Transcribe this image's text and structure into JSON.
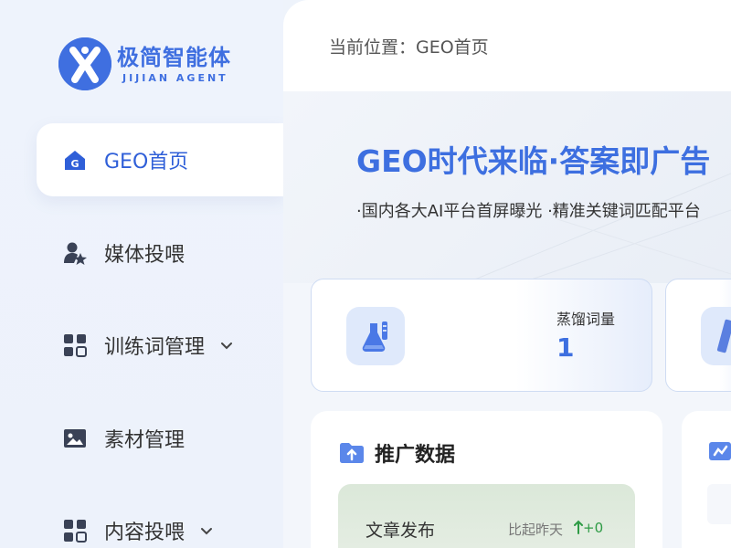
{
  "brand": {
    "name_cn": "极简智能体",
    "name_en": "JIJIAN AGENT",
    "primary_color": "#3f6fe0"
  },
  "sidebar": {
    "items": [
      {
        "label": "GEO首页",
        "icon": "home-g-icon",
        "active": true
      },
      {
        "label": "媒体投喂",
        "icon": "user-star-icon",
        "active": false
      },
      {
        "label": "训练词管理",
        "icon": "grid-icon",
        "active": false,
        "expandable": true
      },
      {
        "label": "素材管理",
        "icon": "image-icon",
        "active": false
      },
      {
        "label": "内容投喂",
        "icon": "grid-icon",
        "active": false,
        "expandable": true
      }
    ]
  },
  "header": {
    "breadcrumb": "当前位置：GEO首页"
  },
  "hero": {
    "title": "GEO时代来临·答案即广告",
    "subtitle": "·国内各大AI平台首屏曝光 ·精准关键词匹配平台"
  },
  "stats": [
    {
      "label": "蒸馏词量",
      "value": "1",
      "icon": "flask-icon"
    }
  ],
  "promo": {
    "title": "推广数据",
    "card": {
      "label": "文章发布",
      "compare": "比起昨天",
      "delta": "+0"
    }
  }
}
